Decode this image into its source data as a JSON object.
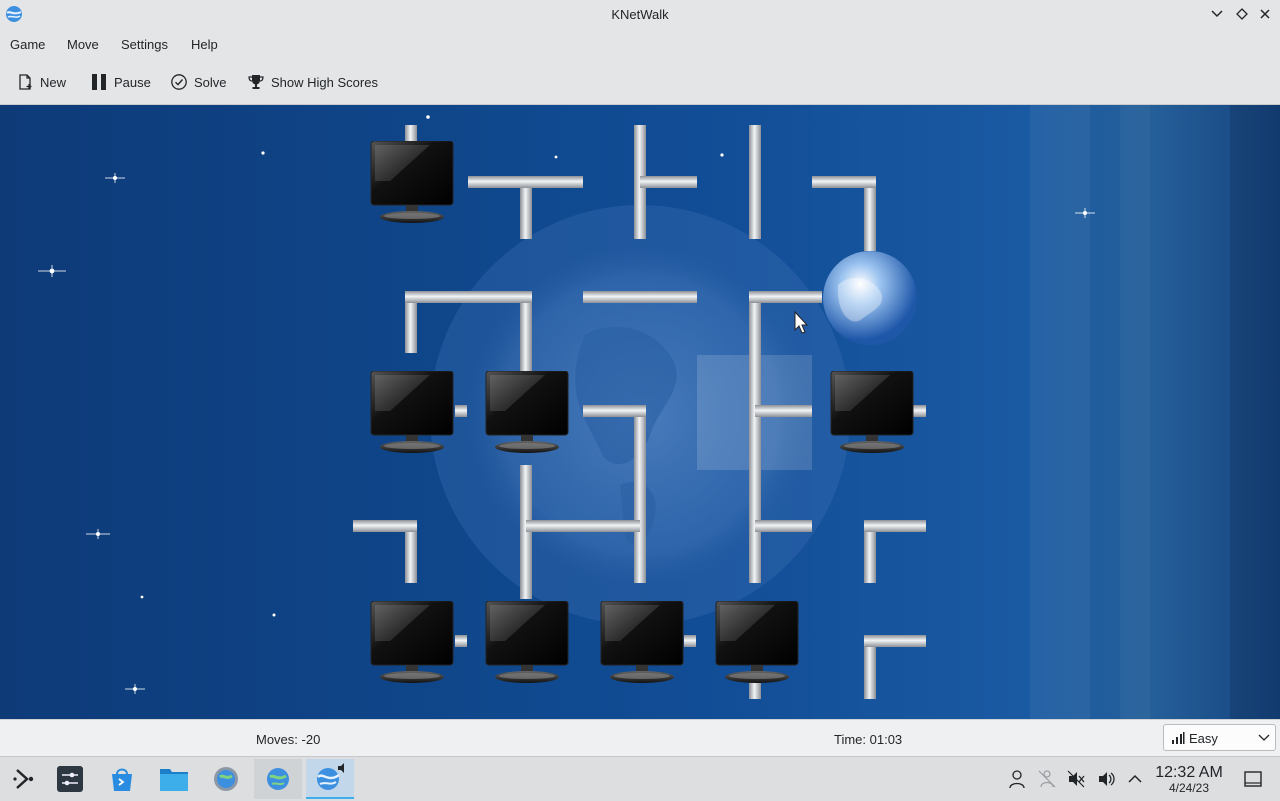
{
  "window": {
    "title": "KNetWalk"
  },
  "menu": {
    "game": "Game",
    "move": "Move",
    "settings": "Settings",
    "help": "Help"
  },
  "toolbar": {
    "new": "New",
    "pause": "Pause",
    "solve": "Solve",
    "high_scores": "Show High Scores"
  },
  "status": {
    "moves": "Moves: -20",
    "time": "Time: 01:03",
    "difficulty": "Easy"
  },
  "clock": {
    "time": "12:32 AM",
    "date": "4/24/23"
  },
  "icons": {
    "app": "knetwalk-globe-icon",
    "new": "new-document-icon",
    "pause": "pause-icon",
    "solve": "check-circle-icon",
    "high_scores": "trophy-icon",
    "difficulty": "signal-bars-icon",
    "tray": [
      "user-icon",
      "network-icon",
      "volume-muted-icon",
      "volume-icon",
      "expand-tray-icon",
      "show-desktop-icon"
    ]
  },
  "colors": {
    "accent": "#3daee9",
    "board_background": "#114d96",
    "pipe": "#c9ccd0"
  }
}
